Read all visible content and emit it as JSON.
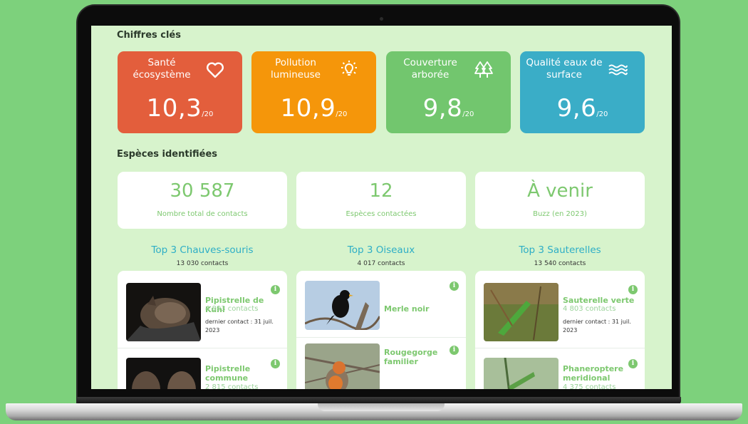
{
  "colors": {
    "accent_green": "#7dc86f",
    "title_blue": "#2eaec6",
    "screen_bg": "#d7f3cc"
  },
  "key_figures": {
    "title": "Chiffres clés",
    "cards": [
      {
        "label": "Santé écosystème",
        "value": "10,3",
        "unit": "/20",
        "icon": "heart-icon",
        "color": "#e35e3c"
      },
      {
        "label": "Pollution lumineuse",
        "value": "10,9",
        "unit": "/20",
        "icon": "lightbulb-icon",
        "color": "#f5960a"
      },
      {
        "label": "Couverture arborée",
        "value": "9,8",
        "unit": "/20",
        "icon": "trees-icon",
        "color": "#72c66e"
      },
      {
        "label": "Qualité eaux de surface",
        "value": "9,6",
        "unit": "/20",
        "icon": "waves-icon",
        "color": "#3aadc7"
      }
    ]
  },
  "species": {
    "title": "Espèces identifiées",
    "stats": [
      {
        "value": "30 587",
        "label": "Nombre total de contacts"
      },
      {
        "value": "12",
        "label": "Espèces contactées"
      },
      {
        "value": "À venir",
        "label": "Buzz (en 2023)"
      }
    ]
  },
  "tops": [
    {
      "title": "Top 3 Chauves-souris",
      "subtitle": "13 030 contacts",
      "items": [
        {
          "name": "Pipistrelle de Kuhl",
          "count": "4 893 contacts",
          "last": "dernier contact : 31 juil. 2023",
          "photo": "bat-photo"
        },
        {
          "name": "Pipistrelle commune",
          "count": "2 815 contacts",
          "last": "",
          "photo": "bat-photo"
        }
      ]
    },
    {
      "title": "Top 3 Oiseaux",
      "subtitle": "4 017 contacts",
      "items": [
        {
          "name": "Merle noir",
          "count": "",
          "last": "",
          "photo": "blackbird-photo"
        },
        {
          "name": "Rougegorge familier",
          "count": "",
          "last": "",
          "photo": "robin-photo"
        }
      ]
    },
    {
      "title": "Top 3 Sauterelles",
      "subtitle": "13 540 contacts",
      "items": [
        {
          "name": "Sauterelle verte",
          "count": "4 803 contacts",
          "last": "dernier contact : 31 juil. 2023",
          "photo": "grasshopper-photo"
        },
        {
          "name": "Phaneroptere meridional",
          "count": "4 375 contacts",
          "last": "",
          "photo": "grasshopper-photo"
        }
      ]
    }
  ],
  "info_glyph": "i"
}
